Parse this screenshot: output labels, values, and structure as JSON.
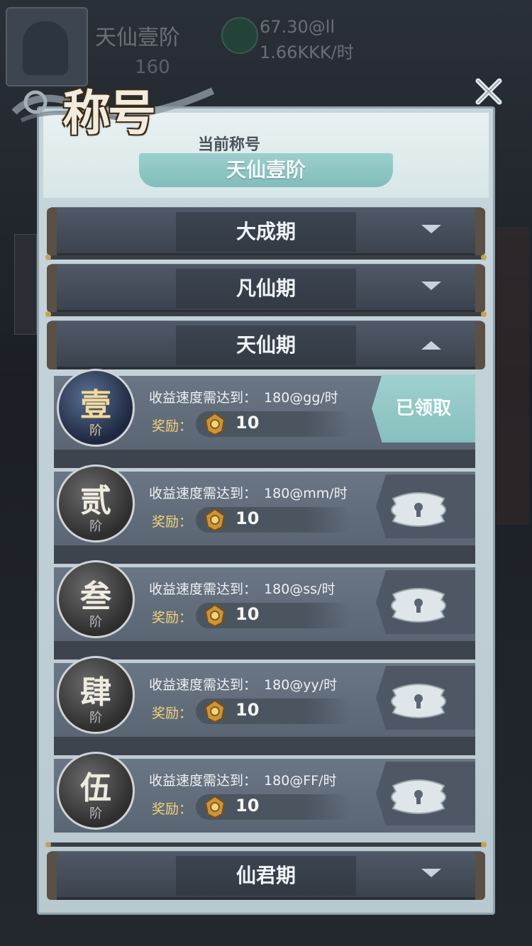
{
  "background": {
    "player_name": "天仙壹阶",
    "player_level": "160",
    "income_rate_1": "67.30@ll",
    "income_rate_2": "1.66KKK/时"
  },
  "dialog": {
    "title": "称号",
    "current_title_label": "当前称号",
    "current_title": "天仙壹阶"
  },
  "categories": [
    {
      "label": "大成期",
      "state": "collapsed"
    },
    {
      "label": "凡仙期",
      "state": "collapsed"
    },
    {
      "label": "天仙期",
      "state": "expanded"
    },
    {
      "label": "仙君期",
      "state": "collapsed"
    }
  ],
  "tiers": [
    {
      "num": "壹",
      "sub": "阶",
      "req_label": "收益速度需达到：",
      "req_value": "180@gg/时",
      "reward_label": "奖励：",
      "reward_value": "10",
      "status": "已领取"
    },
    {
      "num": "贰",
      "sub": "阶",
      "req_label": "收益速度需达到：",
      "req_value": "180@mm/时",
      "reward_label": "奖励：",
      "reward_value": "10",
      "status": "locked"
    },
    {
      "num": "叁",
      "sub": "阶",
      "req_label": "收益速度需达到：",
      "req_value": "180@ss/时",
      "reward_label": "奖励：",
      "reward_value": "10",
      "status": "locked"
    },
    {
      "num": "肆",
      "sub": "阶",
      "req_label": "收益速度需达到：",
      "req_value": "180@yy/时",
      "reward_label": "奖励：",
      "reward_value": "10",
      "status": "locked"
    },
    {
      "num": "伍",
      "sub": "阶",
      "req_label": "收益速度需达到：",
      "req_value": "180@FF/时",
      "reward_label": "奖励：",
      "reward_value": "10",
      "status": "locked"
    }
  ],
  "icons": {
    "close": "close-icon",
    "gem": "gem-icon",
    "lock": "lock-icon",
    "expand": "chevron-down-icon",
    "collapse": "chevron-up-icon"
  },
  "colors": {
    "claimed": "#9fd0ce",
    "reward_label": "#f1d37a",
    "header_bar": "#414a55"
  }
}
